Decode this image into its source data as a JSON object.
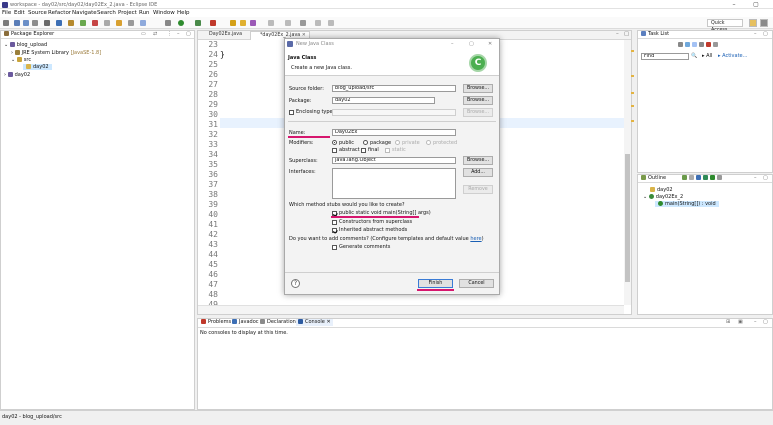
{
  "window": {
    "title": "workspace - day02/src/day02/day02Ex_2.java - Eclipse IDE",
    "minimize": "–",
    "maximize": "▢"
  },
  "menu": [
    "File",
    "Edit",
    "Source",
    "Refactor",
    "Navigate",
    "Search",
    "Project",
    "Run",
    "Window",
    "Help"
  ],
  "quick_access": "Quick Access",
  "package_explorer": {
    "title": "Package Explorer",
    "tree": [
      {
        "label": "blog_upload",
        "detail": ""
      },
      {
        "label": "JRE System Library",
        "detail": "[JavaSE-1.8]"
      },
      {
        "label": "src",
        "detail": ""
      },
      {
        "label": "day02",
        "detail": ""
      },
      {
        "label": "day02",
        "detail": ""
      }
    ]
  },
  "editor": {
    "tabs": [
      {
        "label": "Day02Ex.java"
      },
      {
        "label": "*day02Ex_2.java"
      }
    ],
    "line_numbers": [
      "23",
      "24",
      "25",
      "26",
      "27",
      "28",
      "29",
      "30",
      "31",
      "32",
      "33",
      "34",
      "35",
      "36",
      "37",
      "38",
      "39",
      "40",
      "41",
      "42",
      "43",
      "44",
      "45",
      "46",
      "47",
      "48",
      "49"
    ],
    "code_line_24": "}"
  },
  "task_list": {
    "title": "Task List",
    "find_placeholder": "Find",
    "all": "All",
    "activate": "Activate..."
  },
  "outline": {
    "title": "Outline",
    "items": [
      "day02",
      "day02Ex_2",
      "main(String[]) : void"
    ]
  },
  "console": {
    "tabs": [
      "Problems",
      "Javadoc",
      "Declaration",
      "Console"
    ],
    "message": "No consoles to display at this time."
  },
  "status": {
    "text": "day02 - blog_upload/src"
  },
  "dialog": {
    "window_title": "New Java Class",
    "header_title": "Java Class",
    "header_desc": "Create a new Java class.",
    "source_folder_label": "Source folder:",
    "source_folder_value": "blog_upload/src",
    "package_label": "Package:",
    "package_value": "day02",
    "enclosing_label": "Enclosing type:",
    "browse": "Browse...",
    "name_label": "Name:",
    "name_value": "Day02Ex",
    "modifiers_label": "Modifiers:",
    "mod_public": "public",
    "mod_package": "package",
    "mod_private": "private",
    "mod_protected": "protected",
    "mod_abstract": "abstract",
    "mod_final": "final",
    "mod_static": "static",
    "superclass_label": "Superclass:",
    "superclass_value": "java.lang.Object",
    "interfaces_label": "Interfaces:",
    "add": "Add...",
    "remove": "Remove",
    "stubs_question": "Which method stubs would you like to create?",
    "stub_main": "public static void main(String[] args)",
    "stub_constructors": "Constructors from superclass",
    "stub_inherited": "Inherited abstract methods",
    "comments_question": "Do you want to add comments? (Configure templates and default value ",
    "comments_link": "here",
    "comments_end": ")",
    "generate_comments": "Generate comments",
    "finish": "Finish",
    "cancel": "Cancel",
    "help": "?"
  },
  "colors": {
    "highlight": "#d6166e",
    "link": "#1a5fb4"
  }
}
